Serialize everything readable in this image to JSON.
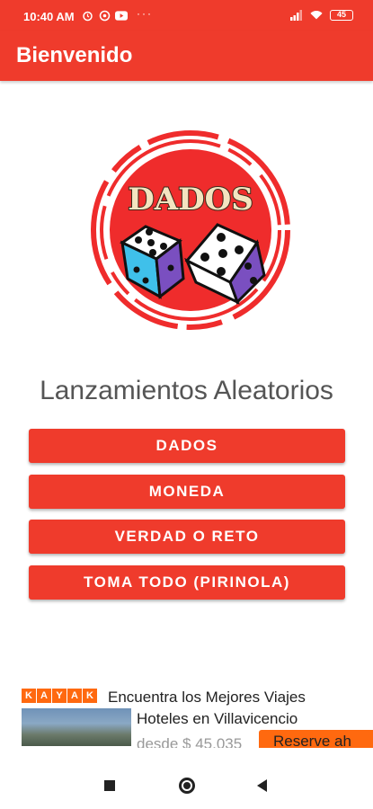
{
  "status_bar": {
    "time": "10:40 AM",
    "dots": "···",
    "battery": "45",
    "icons_left": [
      "alarm-icon",
      "whatsapp-icon",
      "youtube-icon"
    ],
    "icons_right": [
      "signal-icon",
      "wifi-icon",
      "battery-icon"
    ]
  },
  "app_bar": {
    "title": "Bienvenido"
  },
  "logo": {
    "text": "DADOS"
  },
  "headline": "Lanzamientos Aleatorios",
  "buttons": [
    {
      "label": "DADOS"
    },
    {
      "label": "MONEDA"
    },
    {
      "label": "VERDAD O RETO"
    },
    {
      "label": "TOMA TODO (PIRINOLA)"
    }
  ],
  "ad": {
    "brand_letters": [
      "K",
      "A",
      "Y",
      "A",
      "K"
    ],
    "headline": "Encuentra los Mejores Viajes",
    "subtitle": "Hoteles en Villavicencio",
    "price": "desde $ 45.035",
    "cta": "Reserve ah"
  },
  "colors": {
    "primary": "#ef3b2c",
    "kayak": "#ff690f"
  }
}
